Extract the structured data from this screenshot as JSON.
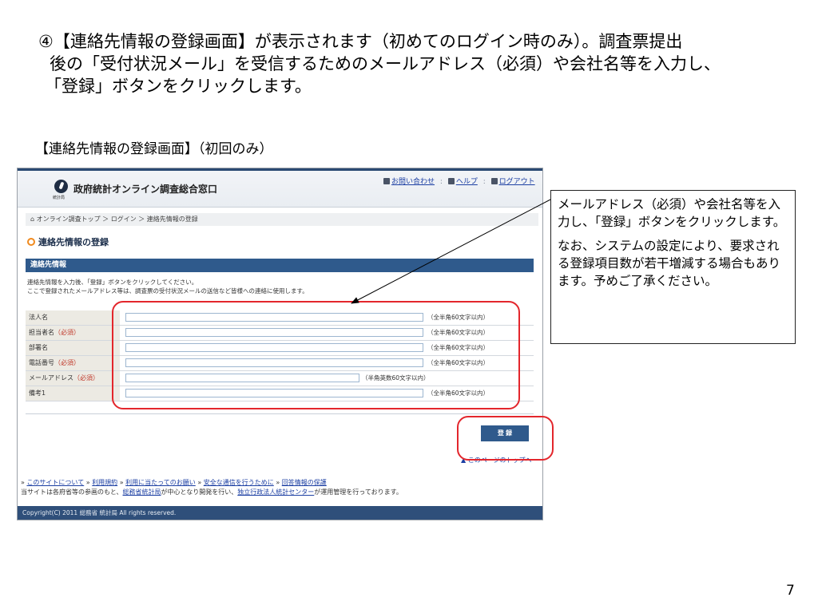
{
  "intro": {
    "line1": "④【連絡先情報の登録画面】が表示されます（初めてのログイン時のみ）。調査票提出",
    "line2": "後の「受付状況メール」を受信するためのメールアドレス（必須）や会社名等を入力し、",
    "line3": "「登録」ボタンをクリックします。"
  },
  "section_label": "【連絡先情報の登録画面】（初回のみ）",
  "screenshot": {
    "logo_sub": "統計局",
    "site_title": "政府統計オンライン調査総合窓口",
    "top_links": {
      "contact": "お問い合わせ",
      "help": "ヘルプ",
      "logout": "ログアウト"
    },
    "breadcrumb": "オンライン調査トップ ＞ ログイン ＞ 連絡先情報の登録",
    "page_title": "連絡先情報の登録",
    "bar_title": "連絡先情報",
    "desc_line1": "連絡先情報を入力後、「登録」ボタンをクリックしてください。",
    "desc_line2": "ここで登録されたメールアドレス等は、調査票の受付状況メールの送信など皆様への連絡に使用します。",
    "fields": [
      {
        "label": "法人名",
        "required": "",
        "hint": "（全半角60文字以内）"
      },
      {
        "label": "担当者名",
        "required": "（必須）",
        "hint": "（全半角60文字以内）"
      },
      {
        "label": "部署名",
        "required": "",
        "hint": "（全半角60文字以内）"
      },
      {
        "label": "電話番号",
        "required": "（必須）",
        "hint": "（全半角60文字以内）"
      },
      {
        "label": "メールアドレス",
        "required": "（必須）",
        "hint": "（半角英数60文字以内）"
      },
      {
        "label": "備考1",
        "required": "",
        "hint": "（全半角60文字以内）"
      }
    ],
    "register_button": "登 録",
    "page_top_link": "このページのトップへ",
    "footer_links": {
      "about": "このサイトについて",
      "terms": "利用規約",
      "requests": "利用に当たってのお願い",
      "security": "安全な通信を行うために",
      "privacy": "回答情報の保護"
    },
    "footer_text": {
      "part1": "当サイトは各府省等の参画のもと、",
      "link1": "総務省統計局",
      "part2": "が中心となり開発を行い、",
      "link2": "独立行政法人統計センター",
      "part3": "が運用管理を行っております。"
    },
    "copyright": "Copyright(C) 2011 総務省 統計局 All rights reserved."
  },
  "callout": {
    "para1": "メールアドレス（必須）や会社名等を入力し、「登録」ボタンをクリックします。",
    "para2": "なお、システムの設定により、要求される登録項目数が若干増減する場合もあります。予めご了承ください。"
  },
  "page_number": "7",
  "colors": {
    "highlight": "#e3262c",
    "header_blue": "#2f5a8c",
    "link": "#1c3fa3",
    "required": "#c0392b"
  }
}
